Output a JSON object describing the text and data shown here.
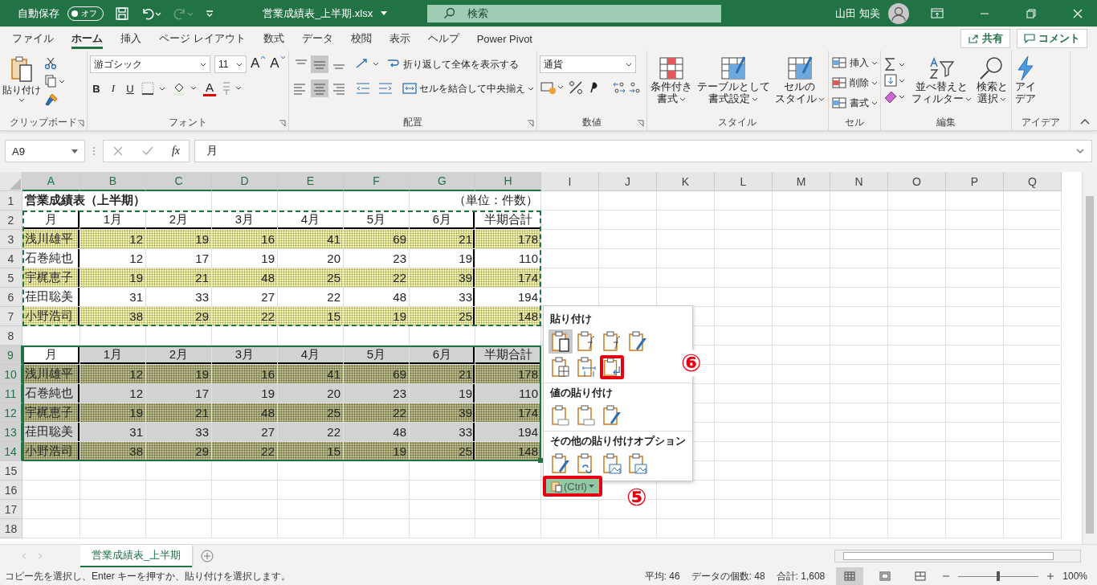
{
  "title_bar": {
    "autosave_label": "自動保存",
    "autosave_toggle": {
      "label": "オフ",
      "on": false
    },
    "filename": "営業成績表_上半期.xlsx",
    "search": {
      "placeholder": "検索"
    },
    "user": "山田 知美"
  },
  "menu_tabs": [
    {
      "label": "ファイル",
      "selected": false
    },
    {
      "label": "ホーム",
      "selected": true
    },
    {
      "label": "挿入",
      "selected": false
    },
    {
      "label": "ページ レイアウト",
      "selected": false
    },
    {
      "label": "数式",
      "selected": false
    },
    {
      "label": "データ",
      "selected": false
    },
    {
      "label": "校閲",
      "selected": false
    },
    {
      "label": "表示",
      "selected": false
    },
    {
      "label": "ヘルプ",
      "selected": false
    },
    {
      "label": "Power Pivot",
      "selected": false
    }
  ],
  "share_button": "共有",
  "comment_button": "コメント",
  "ribbon": {
    "clipboard": {
      "paste": "貼り付け",
      "label": "クリップボード"
    },
    "font": {
      "font_name": "游ゴシック",
      "font_size": "11",
      "grow": "A",
      "shrink": "A",
      "styles": [
        "B",
        "I",
        "U"
      ],
      "font_color": "A",
      "label": "フォント"
    },
    "alignment": {
      "wrap": "折り返して全体を表示する",
      "merge": "セルを結合して中央揃え",
      "label": "配置"
    },
    "number": {
      "format": "通貨",
      "label": "数値"
    },
    "styles": {
      "buttons": [
        [
          "条件付き",
          "書式"
        ],
        [
          "テーブルとして",
          "書式設定"
        ],
        [
          "セルの",
          "スタイル"
        ]
      ],
      "label": "スタイル"
    },
    "cells": {
      "buttons": [
        "挿入",
        "削除",
        "書式"
      ],
      "label": "セル"
    },
    "editing": {
      "buttons": [
        [
          "並べ替えと",
          "フィルター"
        ],
        [
          "検索と",
          "選択"
        ]
      ],
      "label": "編集"
    },
    "ideas": {
      "button": [
        "アイ",
        "デア"
      ],
      "label": "アイデア"
    }
  },
  "formula_bar": {
    "name_box": "A9",
    "fx": "fx",
    "value": "月"
  },
  "sheet": {
    "columns": [
      {
        "label": "A",
        "selected": true
      },
      {
        "label": "B",
        "selected": true
      },
      {
        "label": "C",
        "selected": true
      },
      {
        "label": "D",
        "selected": true
      },
      {
        "label": "E",
        "selected": true
      },
      {
        "label": "F",
        "selected": true
      },
      {
        "label": "G",
        "selected": true
      },
      {
        "label": "H",
        "selected": true
      },
      {
        "label": "I",
        "selected": false
      },
      {
        "label": "J",
        "selected": false
      },
      {
        "label": "K",
        "selected": false
      },
      {
        "label": "L",
        "selected": false
      },
      {
        "label": "M",
        "selected": false
      },
      {
        "label": "N",
        "selected": false
      },
      {
        "label": "O",
        "selected": false
      },
      {
        "label": "P",
        "selected": false
      },
      {
        "label": "Q",
        "selected": false
      }
    ],
    "row_numbers": [
      {
        "label": "1",
        "selected": false
      },
      {
        "label": "2",
        "selected": false
      },
      {
        "label": "3",
        "selected": false
      },
      {
        "label": "4",
        "selected": false
      },
      {
        "label": "5",
        "selected": false
      },
      {
        "label": "6",
        "selected": false
      },
      {
        "label": "7",
        "selected": false
      },
      {
        "label": "8",
        "selected": false
      },
      {
        "label": "9",
        "selected": true
      },
      {
        "label": "10",
        "selected": true
      },
      {
        "label": "11",
        "selected": true
      },
      {
        "label": "12",
        "selected": true
      },
      {
        "label": "13",
        "selected": true
      },
      {
        "label": "14",
        "selected": true
      },
      {
        "label": "15",
        "selected": false
      },
      {
        "label": "16",
        "selected": false
      },
      {
        "label": "17",
        "selected": false
      },
      {
        "label": "18",
        "selected": false
      }
    ],
    "title": "営業成績表（上半期）",
    "unit": "（単位：件数）",
    "blocks": [
      {
        "copied": true,
        "selected": false,
        "header": [
          "月",
          "1月",
          "2月",
          "3月",
          "4月",
          "5月",
          "6月",
          "半期合計"
        ],
        "rows": [
          {
            "striped": true,
            "cells": [
              "浅川雄平",
              "12",
              "19",
              "16",
              "41",
              "69",
              "21",
              "178"
            ]
          },
          {
            "striped": false,
            "cells": [
              "石巻純也",
              "12",
              "17",
              "19",
              "20",
              "23",
              "19",
              "110"
            ]
          },
          {
            "striped": true,
            "cells": [
              "宇梶恵子",
              "19",
              "21",
              "48",
              "25",
              "22",
              "39",
              "174"
            ]
          },
          {
            "striped": false,
            "cells": [
              "荏田聡美",
              "31",
              "33",
              "27",
              "22",
              "48",
              "33",
              "194"
            ]
          },
          {
            "striped": true,
            "cells": [
              "小野浩司",
              "38",
              "29",
              "22",
              "15",
              "19",
              "25",
              "148"
            ]
          }
        ]
      },
      {
        "copied": false,
        "selected": true,
        "header": [
          "月",
          "1月",
          "2月",
          "3月",
          "4月",
          "5月",
          "6月",
          "半期合計"
        ],
        "rows": [
          {
            "striped": true,
            "cells": [
              "浅川雄平",
              "12",
              "19",
              "16",
              "41",
              "69",
              "21",
              "178"
            ]
          },
          {
            "striped": false,
            "cells": [
              "石巻純也",
              "12",
              "17",
              "19",
              "20",
              "23",
              "19",
              "110"
            ]
          },
          {
            "striped": true,
            "cells": [
              "宇梶恵子",
              "19",
              "21",
              "48",
              "25",
              "22",
              "39",
              "174"
            ]
          },
          {
            "striped": false,
            "cells": [
              "荏田聡美",
              "31",
              "33",
              "27",
              "22",
              "48",
              "33",
              "194"
            ]
          },
          {
            "striped": true,
            "cells": [
              "小野浩司",
              "38",
              "29",
              "22",
              "15",
              "19",
              "25",
              "148"
            ]
          }
        ]
      }
    ]
  },
  "paste_menu": {
    "sections": [
      {
        "title": "貼り付け",
        "items": [
          {
            "kind": "paste",
            "selected": true,
            "marked": false
          },
          {
            "kind": "formulas",
            "selected": false,
            "marked": false
          },
          {
            "kind": "formulas-number",
            "selected": false,
            "marked": false
          },
          {
            "kind": "source-format",
            "selected": false,
            "marked": false
          },
          {
            "kind": "no-borders",
            "selected": false,
            "marked": false
          },
          {
            "kind": "column-widths",
            "selected": false,
            "marked": false
          },
          {
            "kind": "transpose",
            "selected": false,
            "marked": true
          }
        ]
      },
      {
        "title": "値の貼り付け",
        "items": [
          {
            "kind": "values",
            "selected": false,
            "marked": false
          },
          {
            "kind": "values-number",
            "selected": false,
            "marked": false
          },
          {
            "kind": "values-source",
            "selected": false,
            "marked": false
          }
        ]
      },
      {
        "title": "その他の貼り付けオプション",
        "items": [
          {
            "kind": "formatting",
            "selected": false,
            "marked": false
          },
          {
            "kind": "link",
            "selected": false,
            "marked": false
          },
          {
            "kind": "picture",
            "selected": false,
            "marked": false
          },
          {
            "kind": "linked-picture",
            "selected": false,
            "marked": false
          }
        ]
      }
    ],
    "ctrl_button": {
      "label": "(Ctrl)",
      "marked": true
    }
  },
  "annotations": [
    "⑥",
    "⑤"
  ],
  "sheet_tabs": [
    {
      "label": "営業成績表_上半期",
      "selected": true
    }
  ],
  "status_bar": {
    "message": "コピー先を選択し、Enter キーを押すか、貼り付けを選択します。",
    "stats": [
      "平均: 46",
      "データの個数: 48",
      "合計: 1,608"
    ],
    "views": [
      {
        "kind": "normal",
        "selected": true
      },
      {
        "kind": "page-layout",
        "selected": false
      },
      {
        "kind": "page-break",
        "selected": false
      }
    ],
    "zoom": {
      "level": 0.5,
      "label": "100%"
    }
  }
}
